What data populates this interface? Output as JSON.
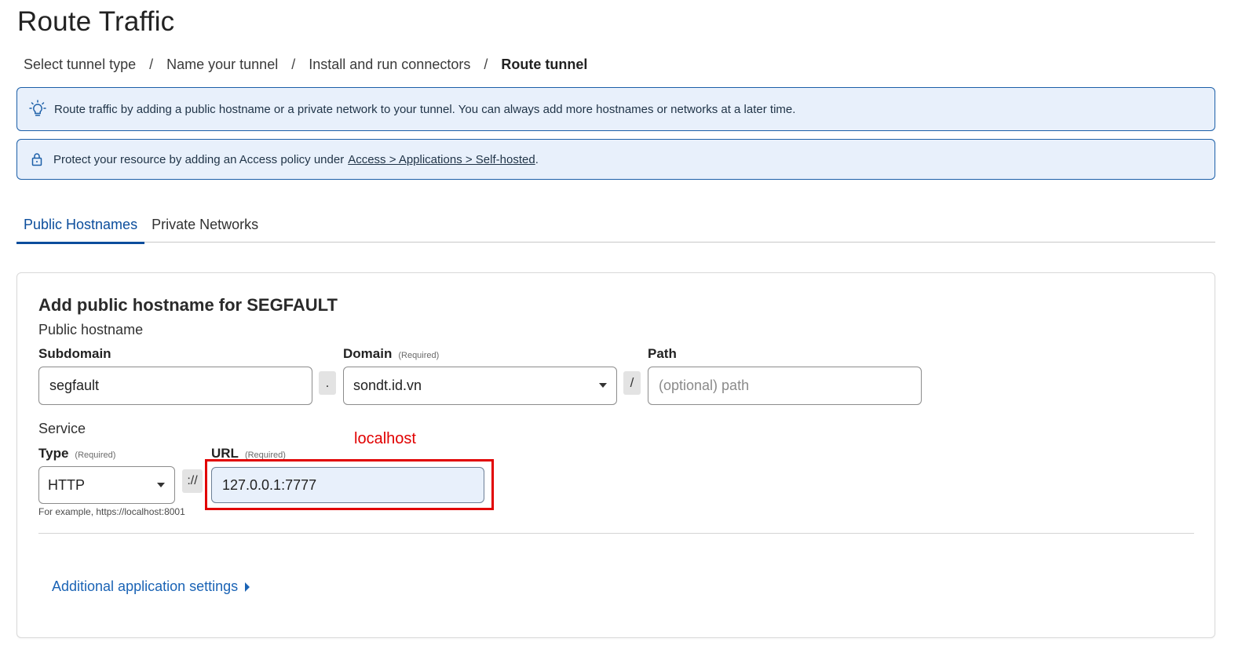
{
  "page": {
    "title": "Route Traffic"
  },
  "breadcrumb": {
    "steps": [
      "Select tunnel type",
      "Name your tunnel",
      "Install and run connectors",
      "Route tunnel"
    ],
    "separator": "/"
  },
  "banners": {
    "info": {
      "icon": "lightbulb-icon",
      "text": "Route traffic by adding a public hostname or a private network to your tunnel. You can always add more hostnames or networks at a later time."
    },
    "protect": {
      "icon": "lock-icon",
      "text_before": "Protect your resource by adding an Access policy under",
      "link": "Access > Applications > Self-hosted",
      "text_after": "."
    }
  },
  "tabs": [
    {
      "label": "Public Hostnames",
      "active": true
    },
    {
      "label": "Private Networks",
      "active": false
    }
  ],
  "form": {
    "title": "Add public hostname for SEGFAULT",
    "hostname_section": "Public hostname",
    "subdomain": {
      "label": "Subdomain",
      "value": "segfault"
    },
    "dot": ".",
    "domain": {
      "label": "Domain",
      "required": "(Required)",
      "value": "sondt.id.vn"
    },
    "slash": "/",
    "path": {
      "label": "Path",
      "placeholder": "(optional) path"
    },
    "service_section": "Service",
    "type": {
      "label": "Type",
      "required": "(Required)",
      "value": "HTTP"
    },
    "scheme_sep": "://",
    "url": {
      "label": "URL",
      "required": "(Required)",
      "value": "127.0.0.1:7777"
    },
    "helper": "For example, https://localhost:8001",
    "annotation": "localhost",
    "additional_settings": "Additional application settings"
  },
  "colors": {
    "accent": "#0b4d9c",
    "banner_bg": "#e8f0fb",
    "banner_border": "#1c5fa8",
    "annotation": "#e10000",
    "link": "#1a63b5"
  }
}
